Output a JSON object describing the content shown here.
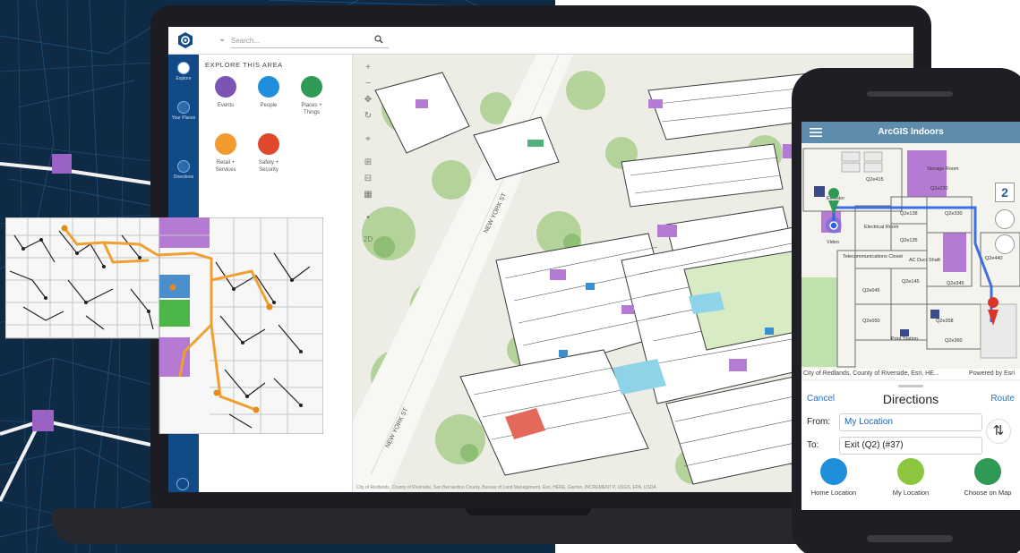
{
  "app": {
    "title": "ArcGIS Indoors",
    "primary_color": "#114a87",
    "header_color": "#5e8cad"
  },
  "desktop": {
    "search_placeholder": "Search...",
    "nav": [
      {
        "label": "Explore",
        "icon": "compass-icon"
      },
      {
        "label": "Your Places",
        "icon": "star-icon"
      },
      {
        "label": "Directions",
        "icon": "directions-icon"
      }
    ],
    "panel_title": "EXPLORE THIS AREA",
    "categories": [
      {
        "label": "Events",
        "color": "#7c54b3",
        "icon": "calendar-icon"
      },
      {
        "label": "People",
        "color": "#1f8fdc",
        "icon": "person-icon"
      },
      {
        "label": "Places +",
        "label2": "Things",
        "color": "#2f9a55",
        "icon": "pin-icon"
      },
      {
        "label": "Retail +",
        "label2": "Services",
        "color": "#f19a2e",
        "icon": "tag-icon"
      },
      {
        "label": "Safety +",
        "label2": "Security",
        "color": "#e0482d",
        "icon": "shield-icon"
      }
    ],
    "map_controls": [
      "+",
      "−",
      "✥",
      "↻",
      "⌖",
      "⊞",
      "⊟",
      "▦",
      "•",
      "2D"
    ],
    "street_labels": [
      "NEW YORK ST",
      "NEW YORK ST"
    ],
    "attribution": "City of Redlands, County of Riverside, San Bernardino County, Bureau of Land Management, Esri, HERE, Garmin, INCREMENT P, USGS, EPA, USDA"
  },
  "mobile": {
    "title": "ArcGIS Indoors",
    "floor": "2",
    "room_labels": [
      "Elevator",
      "Q2e415",
      "Storage Room",
      "Q2e220",
      "Electrical Room",
      "Q2e138",
      "Q2e330",
      "Telecommunications Closet",
      "Q2e135",
      "AC Duct Shaft",
      "Q2e440",
      "Q2e045",
      "Q2e145",
      "Q2e345",
      "Q2e050",
      "Q2e358",
      "Print Station",
      "Q2e360",
      "Video"
    ],
    "attribution": "City of Redlands, County of Riverside, Esri, HE...",
    "powered_by": "Powered by Esri",
    "directions": {
      "cancel": "Cancel",
      "title": "Directions",
      "route": "Route",
      "from_label": "From:",
      "from_value": "My Location",
      "to_label": "To:",
      "to_value": "Exit (Q2) (#37)"
    },
    "quick": [
      {
        "label": "Home Location",
        "color": "#1f8fdc"
      },
      {
        "label": "My Location",
        "color": "#8cc63f"
      },
      {
        "label": "Choose on Map",
        "color": "#2f9a55"
      }
    ]
  }
}
